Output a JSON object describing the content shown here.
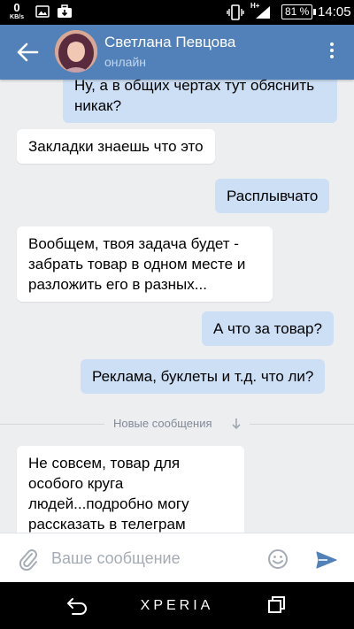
{
  "status_bar": {
    "speed_value": "0",
    "speed_unit": "KB/s",
    "network_label": "H+",
    "battery": "81 %",
    "time": "14:05"
  },
  "header": {
    "contact_name": "Светлана Певцова",
    "contact_status": "онлайн",
    "color": "#5181b8"
  },
  "messages": [
    {
      "direction": "out",
      "text": "Ну, а в общих чертах тут обяснить никак?"
    },
    {
      "direction": "in",
      "text": "Закладки знаешь что это"
    },
    {
      "direction": "out",
      "text": "Расплывчато"
    },
    {
      "direction": "in",
      "text": "Вообщем, твоя задача будет - забрать товар в одном месте и разложить его в разных..."
    },
    {
      "direction": "out",
      "text": "А что за товар?"
    },
    {
      "direction": "out",
      "text": "Реклама, буклеты и т.д. что ли?"
    },
    {
      "direction": "in",
      "text": "Не совсем, товар для особого круга людей...подробно могу рассказать в телеграм"
    }
  ],
  "divider": {
    "label": "Новые сообщения"
  },
  "composer": {
    "placeholder": "Ваше сообщение",
    "value": ""
  },
  "nav_bar": {
    "brand": "XPERIA"
  },
  "colors": {
    "incoming_bubble": "#ffffff",
    "outgoing_bubble": "#cddff5",
    "chat_background": "#edeef0",
    "send_icon": "#5181b8"
  }
}
